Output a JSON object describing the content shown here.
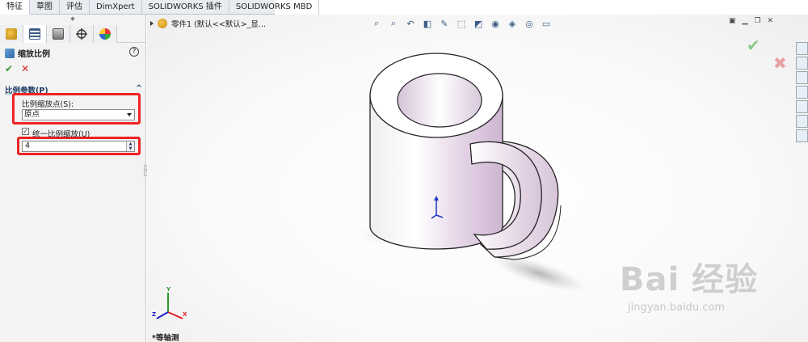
{
  "tabs": [
    {
      "label": "特征",
      "active": true
    },
    {
      "label": "草图",
      "active": false
    },
    {
      "label": "评估",
      "active": false
    },
    {
      "label": "DimXpert",
      "active": false
    },
    {
      "label": "SOLIDWORKS 插件",
      "active": false
    },
    {
      "label": "SOLIDWORKS MBD",
      "active": false
    }
  ],
  "panel_tabs": [
    "feature-manager-icon",
    "property-manager-icon",
    "configuration-manager-icon",
    "dimxpert-manager-icon",
    "display-manager-icon"
  ],
  "property_manager": {
    "title": "缩放比例",
    "help": "?",
    "ok": "✔",
    "cancel": "✕",
    "group_title": "比例参数(P)",
    "group_toggle": "^",
    "scale_point_label": "比例缩放点(S):",
    "scale_point_value": "原点",
    "uniform_label": "统一比例缩放(U)",
    "uniform_checked": true,
    "uniform_mark": "✓",
    "scale_value": "4"
  },
  "tree": {
    "label": "零件1  (默认<<默认>_显..."
  },
  "view_name": "*等轴测",
  "triad": {
    "x": "X",
    "y": "Y",
    "z": "Z"
  },
  "watermark": {
    "brand": "Bai 经验",
    "url": "jingyan.baidu.com"
  },
  "colors": {
    "accent_red": "#ee2323",
    "ok_green": "#2e9b2e",
    "cancel_red": "#d3262b",
    "mug_tint": "#d9c2dc"
  }
}
